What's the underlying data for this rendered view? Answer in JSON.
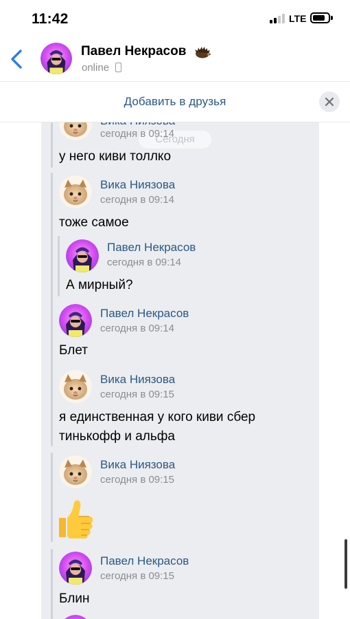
{
  "status_bar": {
    "time": "11:42",
    "network": "LTE"
  },
  "header": {
    "name": "Павел Некрасов",
    "status": "online",
    "name_icon": "hedgehog-icon",
    "back_icon": "chevron-left-icon"
  },
  "add_friend": {
    "label": "Добавить в друзья",
    "close_icon": "close-icon"
  },
  "conversation": {
    "date_pill": "Сегодня",
    "messages": [
      {
        "author": "Вика Ниязова",
        "time": "сегодня в 09:14",
        "text": "у него киви толлко"
      },
      {
        "author": "Вика Ниязова",
        "time": "сегодня в 09:14",
        "text": "тоже самое"
      },
      {
        "author": "Павел Некрасов",
        "time": "сегодня в 09:14",
        "text": "А мирный?"
      },
      {
        "author": "Павел Некрасов",
        "time": "сегодня в 09:14",
        "text": "Блет"
      },
      {
        "author": "Вика Ниязова",
        "time": "сегодня в 09:15",
        "text_line1": "я единственная у кого киви сбер",
        "text_line2": "тинькофф и альфа"
      },
      {
        "author": "Вика Ниязова",
        "time": "сегодня в 09:15",
        "sticker": "thumbs-up-emoji"
      },
      {
        "author": "Павел Некрасов",
        "time": "сегодня в 09:15",
        "text": "Блин"
      }
    ]
  },
  "colors": {
    "link_blue": "#2a5885",
    "back_blue": "#2b7ee8",
    "conversation_bg": "#ebedf0",
    "meta_gray": "#8a8d91"
  }
}
